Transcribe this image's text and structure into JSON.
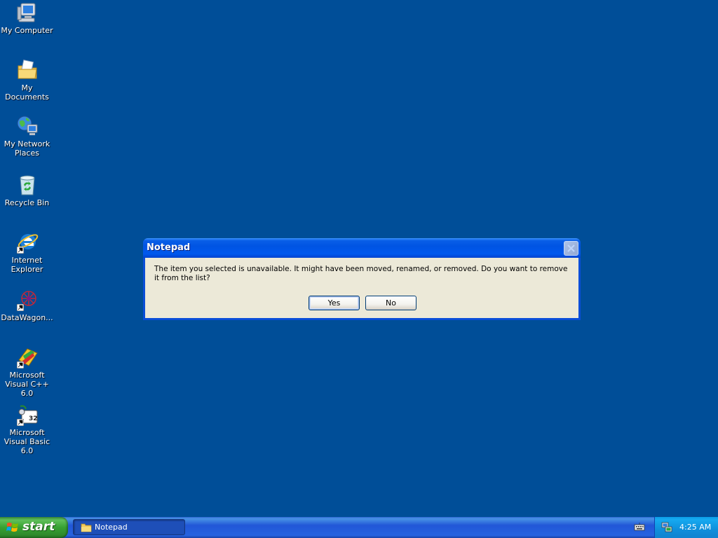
{
  "desktop": {
    "icons": [
      {
        "label": "My Computer",
        "icon": "my-computer-icon"
      },
      {
        "label": "My Documents",
        "icon": "my-documents-icon"
      },
      {
        "label": "My Network Places",
        "icon": "network-places-icon"
      },
      {
        "label": "Recycle Bin",
        "icon": "recycle-bin-icon"
      },
      {
        "label": "Internet Explorer",
        "icon": "internet-explorer-icon"
      },
      {
        "label": "DataWagon...",
        "icon": "datawagon-icon"
      },
      {
        "label": "Microsoft Visual C++ 6.0",
        "icon": "visual-cpp-icon"
      },
      {
        "label": "Microsoft Visual Basic 6.0",
        "icon": "visual-basic-icon"
      }
    ]
  },
  "dialog": {
    "title": "Notepad",
    "message": "The item you selected is unavailable.  It might have been moved, renamed, or removed.  Do you want to remove it from the list?",
    "yes_label": "Yes",
    "no_label": "No",
    "close_icon": "close-icon"
  },
  "taskbar": {
    "start_label": "start",
    "task_label": "Notepad",
    "task_icon": "folder-icon",
    "tray_time": "4:25 AM"
  },
  "colors": {
    "desktop_background": "#004e98",
    "titlebar": "#0054e3",
    "dialog_body": "#ece9d8",
    "start_button": "#37a132",
    "taskbar": "#245edb",
    "tray": "#0f8fdb"
  }
}
